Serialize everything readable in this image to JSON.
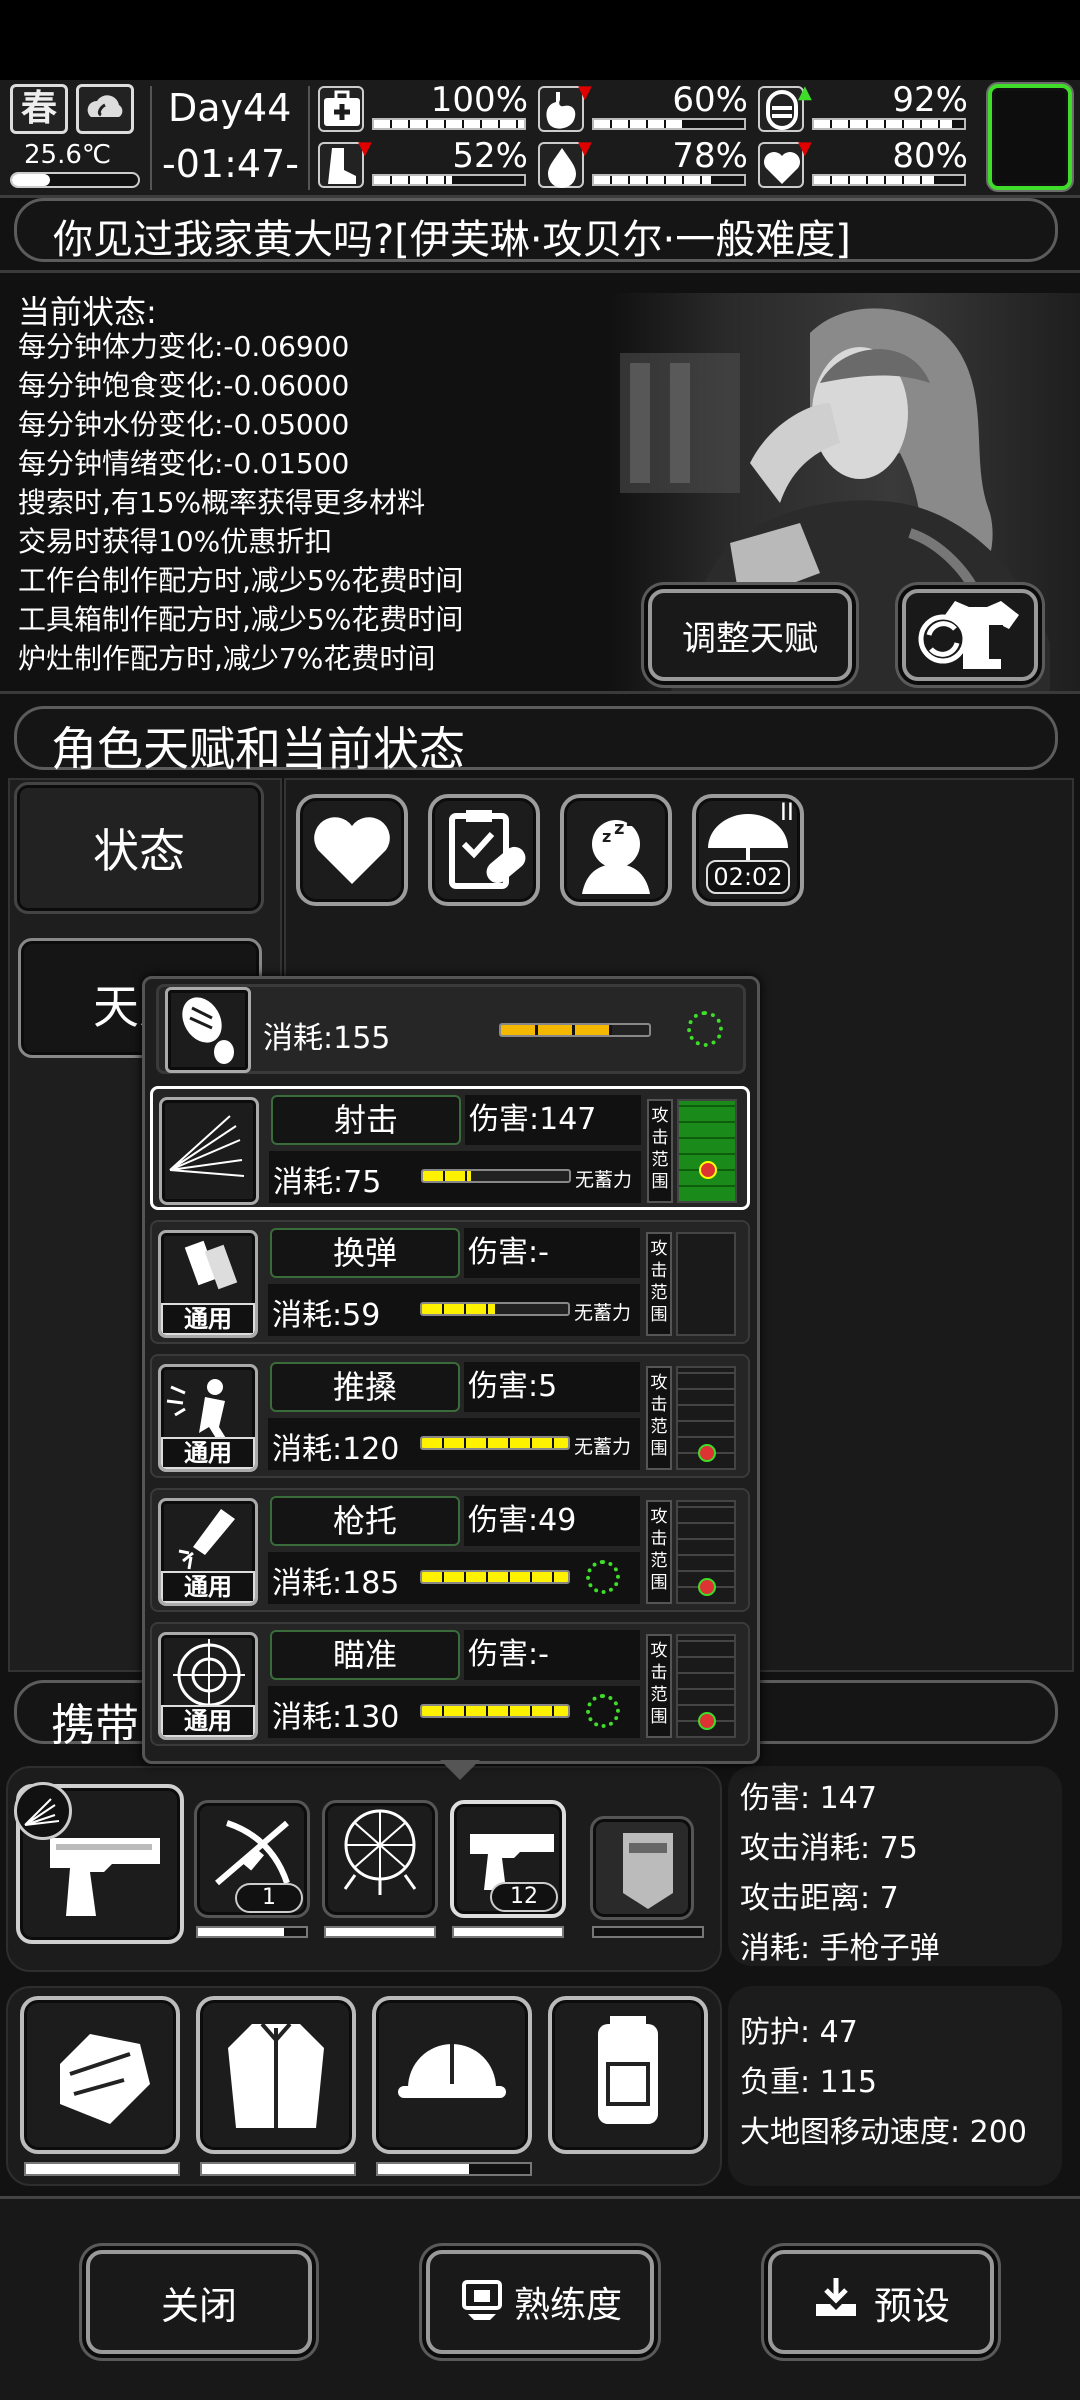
{
  "status_bar": {
    "season": "春",
    "temperature": "25.6℃",
    "day": "Day44",
    "time": "-01:47-",
    "stats": [
      {
        "icon": "health-icon",
        "value": "100%",
        "level": 1.0,
        "arrow": ""
      },
      {
        "icon": "stomach-icon",
        "value": "60%",
        "level": 0.6,
        "arrow": "down"
      },
      {
        "icon": "mood-icon",
        "value": "92%",
        "level": 0.92,
        "arrow": "up"
      },
      {
        "icon": "stamina-boot-icon",
        "value": "52%",
        "level": 0.52,
        "arrow": "down"
      },
      {
        "icon": "water-drop-icon",
        "value": "78%",
        "level": 0.78,
        "arrow": "down"
      },
      {
        "icon": "heart-icon",
        "value": "80%",
        "level": 0.8,
        "arrow": "down"
      }
    ]
  },
  "character": {
    "name_banner": "你见过我家黄大吗?[伊芙琳·攻贝尔·一般难度]",
    "status_title": "当前状态:",
    "status_lines": [
      "每分钟体力变化:-0.06900",
      "每分钟饱食变化:-0.06000",
      "每分钟水份变化:-0.05000",
      "每分钟情绪变化:-0.01500",
      "搜索时,有15%概率获得更多材料",
      "交易时获得10%优惠折扣",
      "工作台制作配方时,减少5%花费时间",
      "工具箱制作配方时,减少5%花费时间",
      "炉灶制作配方时,减少7%花费时间"
    ],
    "adjust_button": "调整天赋"
  },
  "section_title": "角色天赋和当前状态",
  "side_tabs": {
    "status": "状态",
    "talent": "天赋"
  },
  "buffs": {
    "umbrella_level": "II",
    "umbrella_timer": "02:02"
  },
  "carry_title": "携带",
  "skills": {
    "top": {
      "cost": "消耗:155",
      "level": 0.75
    },
    "items": [
      {
        "name": "射击",
        "damage": "伤害:147",
        "cost": "消耗:75",
        "charge": "无蓄力",
        "level": 0.33,
        "range": "攻击范围",
        "selected": true,
        "tag": ""
      },
      {
        "name": "换弹",
        "damage": "伤害:-",
        "cost": "消耗:59",
        "charge": "无蓄力",
        "level": 0.5,
        "range": "攻击范围",
        "selected": false,
        "tag": "通用"
      },
      {
        "name": "推搡",
        "damage": "伤害:5",
        "cost": "消耗:120",
        "charge": "无蓄力",
        "level": 1.0,
        "range": "攻击范围",
        "selected": false,
        "tag": "通用"
      },
      {
        "name": "枪托",
        "damage": "伤害:49",
        "cost": "消耗:185",
        "charge": "",
        "level": 1.0,
        "range": "攻击范围",
        "selected": false,
        "tag": "通用"
      },
      {
        "name": "瞄准",
        "damage": "伤害:-",
        "cost": "消耗:130",
        "charge": "",
        "level": 1.0,
        "range": "攻击范围",
        "selected": false,
        "tag": "通用"
      }
    ]
  },
  "weapon_slots": [
    {
      "count": ""
    },
    {
      "count": "1"
    },
    {
      "count": ""
    },
    {
      "count": "12"
    },
    {
      "count": ""
    }
  ],
  "weapon_info": {
    "damage": "伤害: 147",
    "attack_cost": "攻击消耗: 75",
    "attack_range": "攻击距离: 7",
    "ammo": "消耗: 手枪子弹"
  },
  "armor_info": {
    "defense": "防护: 47",
    "load": "负重: 115",
    "map_speed": "大地图移动速度: 200"
  },
  "bottom_buttons": {
    "close": "关闭",
    "proficiency": "熟练度",
    "preset": "预设"
  },
  "colors": {
    "accent_green": "#3fdc2a",
    "bar_yellow": "#f4b800",
    "arrow_red": "#e00000"
  }
}
